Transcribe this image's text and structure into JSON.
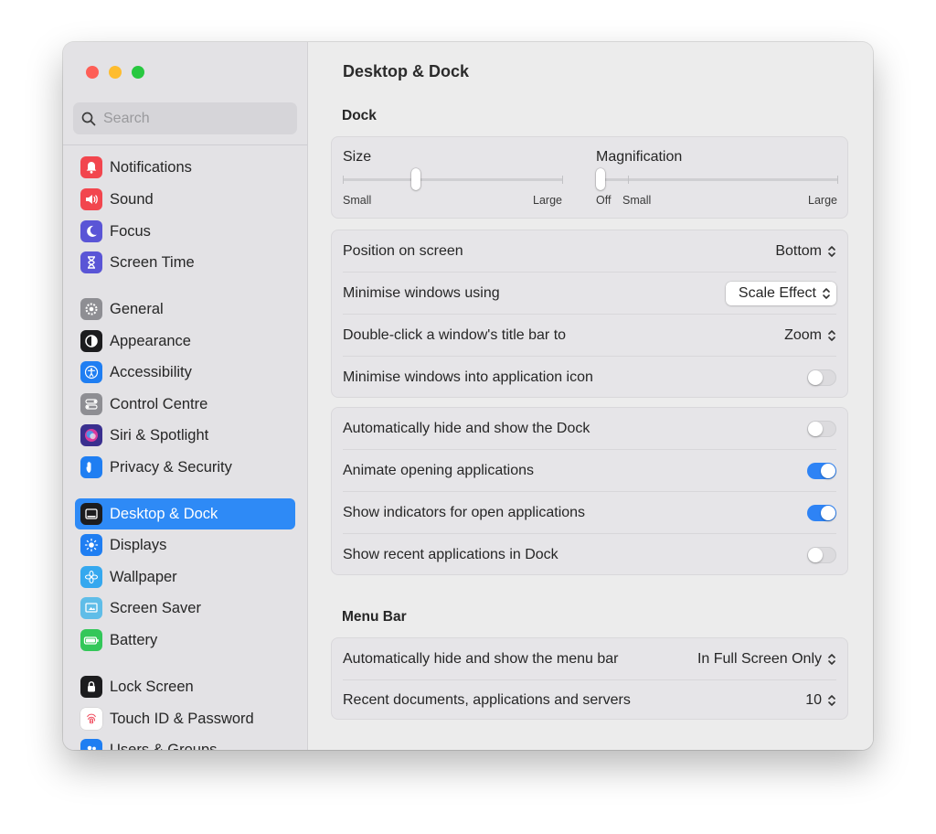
{
  "window": {
    "title": "Desktop & Dock"
  },
  "sidebar": {
    "search_placeholder": "Search",
    "items": [
      {
        "label": "Notifications",
        "icon": "bell-icon",
        "color": "#f2464e"
      },
      {
        "label": "Sound",
        "icon": "speaker-icon",
        "color": "#f2464e"
      },
      {
        "label": "Focus",
        "icon": "moon-icon",
        "color": "#5a55d6"
      },
      {
        "label": "Screen Time",
        "icon": "hourglass-icon",
        "color": "#5a55d6"
      },
      {
        "label": "General",
        "icon": "gear-icon",
        "color": "#8e8e93"
      },
      {
        "label": "Appearance",
        "icon": "appearance-icon",
        "color": "#1c1c1e"
      },
      {
        "label": "Accessibility",
        "icon": "accessibility-icon",
        "color": "#1f7ef2"
      },
      {
        "label": "Control Centre",
        "icon": "control-centre-icon",
        "color": "#8e8e93"
      },
      {
        "label": "Siri & Spotlight",
        "icon": "siri-icon",
        "color": "#3a2f8f"
      },
      {
        "label": "Privacy & Security",
        "icon": "hand-icon",
        "color": "#1f7ef2"
      },
      {
        "label": "Desktop & Dock",
        "icon": "dock-icon",
        "color": "#1c1c1e"
      },
      {
        "label": "Displays",
        "icon": "sun-icon",
        "color": "#1f7ef2"
      },
      {
        "label": "Wallpaper",
        "icon": "flower-icon",
        "color": "#35a8ef"
      },
      {
        "label": "Screen Saver",
        "icon": "screen-saver-icon",
        "color": "#5fbde8"
      },
      {
        "label": "Battery",
        "icon": "battery-icon",
        "color": "#33c759"
      },
      {
        "label": "Lock Screen",
        "icon": "lock-icon",
        "color": "#1c1c1e"
      },
      {
        "label": "Touch ID & Password",
        "icon": "fingerprint-icon",
        "color": "#ffffff"
      },
      {
        "label": "Users & Groups",
        "icon": "users-icon",
        "color": "#1f7ef2"
      }
    ],
    "active_item": "Desktop & Dock"
  },
  "main": {
    "title": "Desktop & Dock",
    "dock_section": "Dock",
    "size": {
      "label": "Size",
      "min_label": "Small",
      "max_label": "Large",
      "value": 0.33
    },
    "magnification": {
      "label": "Magnification",
      "off_label": "Off",
      "min_label": "Small",
      "max_label": "Large",
      "value": 0
    },
    "group1": [
      {
        "label": "Position on screen",
        "type": "popup",
        "value": "Bottom"
      },
      {
        "label": "Minimise windows using",
        "type": "popup-boxed",
        "value": "Scale Effect"
      },
      {
        "label": "Double-click a window's title bar to",
        "type": "popup",
        "value": "Zoom"
      },
      {
        "label": "Minimise windows into application icon",
        "type": "toggle",
        "on": false
      }
    ],
    "group2": [
      {
        "label": "Automatically hide and show the Dock",
        "type": "toggle",
        "on": false
      },
      {
        "label": "Animate opening applications",
        "type": "toggle",
        "on": true
      },
      {
        "label": "Show indicators for open applications",
        "type": "toggle",
        "on": true
      },
      {
        "label": "Show recent applications in Dock",
        "type": "toggle",
        "on": false
      }
    ],
    "menubar_section": "Menu Bar",
    "group3": [
      {
        "label": "Automatically hide and show the menu bar",
        "type": "popup",
        "value": "In Full Screen Only"
      },
      {
        "label": "Recent documents, applications and servers",
        "type": "popup",
        "value": "10"
      }
    ]
  },
  "colors": {
    "accent": "#2e8af6",
    "toggle_on": "#2e83f5"
  }
}
